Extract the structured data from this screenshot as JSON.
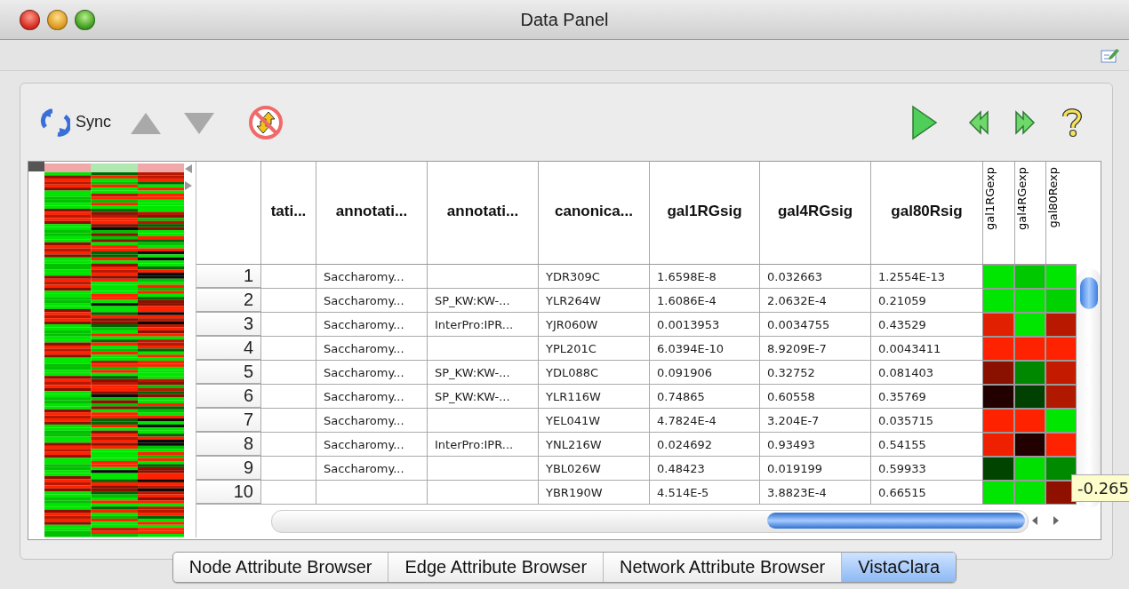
{
  "window": {
    "title": "Data Panel"
  },
  "toolbar": {
    "sync_label": "Sync"
  },
  "table": {
    "columns": [
      {
        "label": "tati...",
        "kind": "text"
      },
      {
        "label": "annotati...",
        "kind": "text"
      },
      {
        "label": "annotati...",
        "kind": "text"
      },
      {
        "label": "canonica...",
        "kind": "text"
      },
      {
        "label": "gal1RGsig",
        "kind": "text"
      },
      {
        "label": "gal4RGsig",
        "kind": "text"
      },
      {
        "label": "gal80Rsig",
        "kind": "text"
      },
      {
        "label": "gal1RGexp",
        "kind": "heat"
      },
      {
        "label": "gal4RGexp",
        "kind": "heat"
      },
      {
        "label": "gal80Rexp",
        "kind": "heat"
      }
    ],
    "rows": [
      {
        "number": "1",
        "cells": [
          "",
          "Saccharomy...",
          "",
          "YDR309C",
          "1.6598E-8",
          "0.032663",
          "1.2554E-13"
        ],
        "heat": [
          {
            "color": "#00e600"
          },
          {
            "color": "#00c800"
          },
          {
            "color": "#00e600"
          }
        ]
      },
      {
        "number": "2",
        "cells": [
          "",
          "Saccharomy...",
          "SP_KW:KW-...",
          "YLR264W",
          "1.6086E-4",
          "2.0632E-4",
          "0.21059"
        ],
        "heat": [
          {
            "color": "#00e600"
          },
          {
            "color": "#00e600"
          },
          {
            "color": "#00d200"
          }
        ]
      },
      {
        "number": "3",
        "cells": [
          "",
          "Saccharomy...",
          "InterPro:IPR...",
          "YJR060W",
          "0.0013953",
          "0.0034755",
          "0.43529"
        ],
        "heat": [
          {
            "color": "#e02000"
          },
          {
            "color": "#00e600"
          },
          {
            "color": "#b81800"
          }
        ]
      },
      {
        "number": "4",
        "cells": [
          "",
          "Saccharomy...",
          "",
          "YPL201C",
          "6.0394E-10",
          "8.9209E-7",
          "0.0043411"
        ],
        "heat": [
          {
            "color": "#ff2200"
          },
          {
            "color": "#ff2200"
          },
          {
            "color": "#ff2200"
          }
        ]
      },
      {
        "number": "5",
        "cells": [
          "",
          "Saccharomy...",
          "SP_KW:KW-...",
          "YDL088C",
          "0.091906",
          "0.32752",
          "0.081403"
        ],
        "heat": [
          {
            "color": "#8a1000"
          },
          {
            "color": "#008800"
          },
          {
            "color": "#c41a00"
          }
        ]
      },
      {
        "number": "6",
        "cells": [
          "",
          "Saccharomy...",
          "SP_KW:KW-...",
          "YLR116W",
          "0.74865",
          "0.60558",
          "0.35769"
        ],
        "heat": [
          {
            "color": "#220000"
          },
          {
            "color": "#004000"
          },
          {
            "color": "#b01800"
          }
        ]
      },
      {
        "number": "7",
        "cells": [
          "",
          "Saccharomy...",
          "",
          "YEL041W",
          "4.7824E-4",
          "3.204E-7",
          "0.035715"
        ],
        "heat": [
          {
            "color": "#ff2200"
          },
          {
            "color": "#ff2200"
          },
          {
            "color": "#00e600"
          }
        ]
      },
      {
        "number": "8",
        "cells": [
          "",
          "Saccharomy...",
          "InterPro:IPR...",
          "YNL216W",
          "0.024692",
          "0.93493",
          "0.54155"
        ],
        "heat": [
          {
            "color": "#ee2000"
          },
          {
            "color": "#220000"
          },
          {
            "color": "#ff2200"
          }
        ]
      },
      {
        "number": "9",
        "cells": [
          "",
          "Saccharomy...",
          "",
          "YBL026W",
          "0.48423",
          "0.019199",
          "0.59933"
        ],
        "heat": [
          {
            "color": "#004400"
          },
          {
            "color": "#00e000"
          },
          {
            "color": "#008a00"
          }
        ]
      },
      {
        "number": "10",
        "cells": [
          "",
          "",
          "",
          "YBR190W",
          "4.514E-5",
          "3.8823E-4",
          "0.66515"
        ],
        "heat": [
          {
            "color": "#00e600"
          },
          {
            "color": "#00e600"
          },
          {
            "color": "#901000"
          }
        ]
      }
    ]
  },
  "tooltip": "-0.265",
  "tabs": [
    {
      "label": "Node Attribute Browser",
      "selected": false
    },
    {
      "label": "Edge Attribute Browser",
      "selected": false
    },
    {
      "label": "Network Attribute Browser",
      "selected": false
    },
    {
      "label": "VistaClara",
      "selected": true
    }
  ]
}
